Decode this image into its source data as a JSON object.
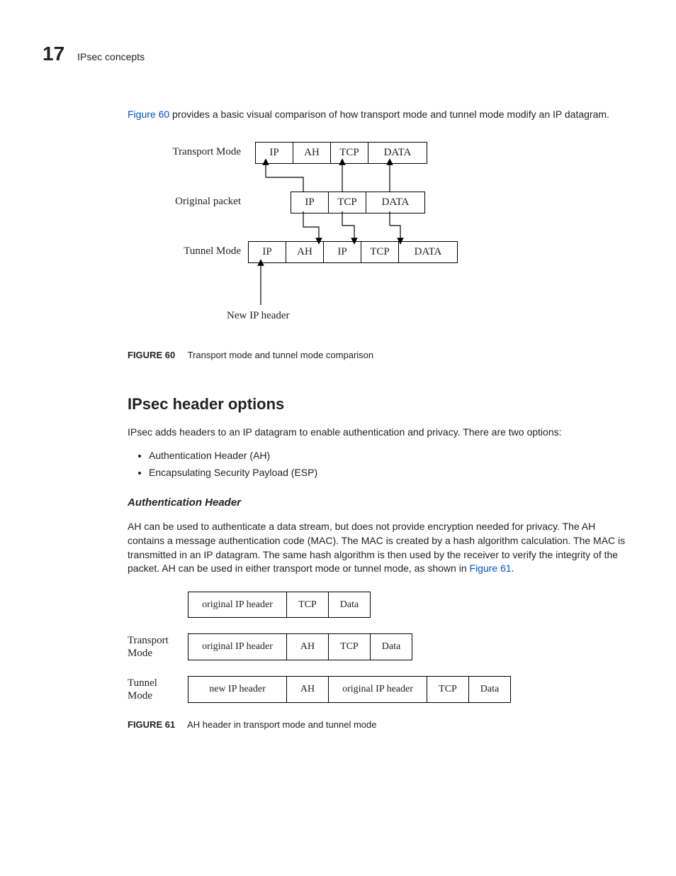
{
  "header": {
    "page_number": "17",
    "section_title": "IPsec concepts"
  },
  "intro": {
    "link_text": "Figure 60",
    "rest": " provides a basic visual comparison of how transport mode and tunnel mode modify an IP datagram."
  },
  "fig60": {
    "row_transport_label": "Transport Mode",
    "row_original_label": "Original packet",
    "row_tunnel_label": "Tunnel Mode",
    "new_ip_label": "New IP header",
    "transport_cells": [
      "IP",
      "AH",
      "TCP",
      "DATA"
    ],
    "original_cells": [
      "IP",
      "TCP",
      "DATA"
    ],
    "tunnel_cells": [
      "IP",
      "AH",
      "IP",
      "TCP",
      "DATA"
    ],
    "caption_label": "FIGURE 60",
    "caption_text": "Transport mode and tunnel mode comparison"
  },
  "section": {
    "h2": "IPsec header options",
    "intro": "IPsec adds headers to an IP datagram to enable authentication and privacy. There are two options:",
    "bullets": [
      "Authentication Header (AH)",
      "Encapsulating Security Payload (ESP)"
    ],
    "h3": "Authentication Header",
    "ah_para_a": "AH can be used to authenticate a data stream, but does not provide encryption needed for privacy. The AH contains a message authentication code (MAC). The MAC is created by a hash algorithm calculation. The MAC is transmitted in an IP datagram. The same hash algorithm is then used by the receiver to verify the integrity of the packet. AH can be used in either transport mode or tunnel mode, as shown in ",
    "ah_link": "Figure 61",
    "ah_para_b": "."
  },
  "fig61": {
    "row1": {
      "label": "",
      "cells": [
        "original IP header",
        "TCP",
        "Data"
      ]
    },
    "row2": {
      "label": "Transport Mode",
      "cells": [
        "original IP header",
        "AH",
        "TCP",
        "Data"
      ]
    },
    "row3": {
      "label": "Tunnel Mode",
      "cells": [
        "new IP header",
        "AH",
        "original IP header",
        "TCP",
        "Data"
      ]
    },
    "caption_label": "FIGURE 61",
    "caption_text": "AH header in transport mode and tunnel mode"
  },
  "chart_data": [
    {
      "type": "table",
      "title": "Figure 60: Transport mode and tunnel mode comparison",
      "rows": [
        {
          "label": "Transport Mode",
          "fields": [
            "IP",
            "AH",
            "TCP",
            "DATA"
          ]
        },
        {
          "label": "Original packet",
          "fields": [
            "IP",
            "TCP",
            "DATA"
          ]
        },
        {
          "label": "Tunnel Mode",
          "fields": [
            "IP",
            "AH",
            "IP",
            "TCP",
            "DATA"
          ],
          "note": "first IP is New IP header"
        }
      ],
      "arrows": [
        "Original IP -> Transport IP",
        "Original TCP -> Transport TCP",
        "Original DATA -> Transport DATA",
        "Original IP -> Tunnel inner IP",
        "Original TCP -> Tunnel TCP",
        "Original DATA -> Tunnel DATA",
        "New IP header -> Tunnel outer IP"
      ]
    },
    {
      "type": "table",
      "title": "Figure 61: AH header in transport mode and tunnel mode",
      "rows": [
        {
          "label": "",
          "fields": [
            "original IP header",
            "TCP",
            "Data"
          ]
        },
        {
          "label": "Transport Mode",
          "fields": [
            "original IP header",
            "AH",
            "TCP",
            "Data"
          ]
        },
        {
          "label": "Tunnel Mode",
          "fields": [
            "new IP header",
            "AH",
            "original IP header",
            "TCP",
            "Data"
          ]
        }
      ]
    }
  ]
}
